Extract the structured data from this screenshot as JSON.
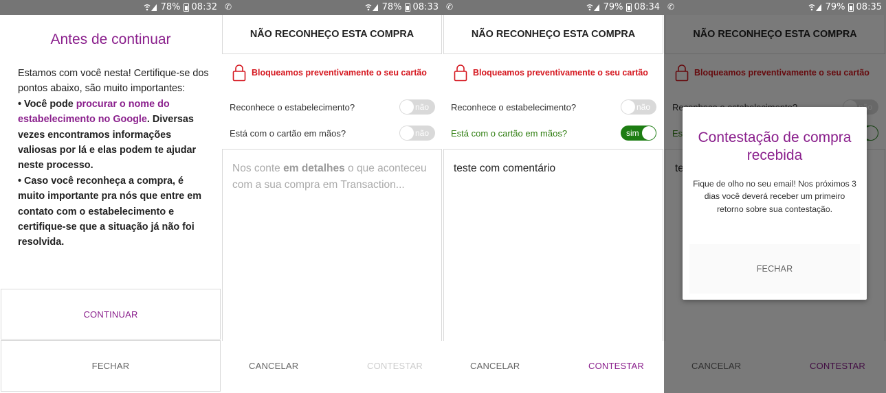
{
  "status_bars": [
    {
      "whatsapp": false,
      "battery": "78%",
      "time": "08:32"
    },
    {
      "whatsapp": true,
      "battery": "78%",
      "time": "08:33"
    },
    {
      "whatsapp": true,
      "battery": "79%",
      "time": "08:34"
    },
    {
      "whatsapp": true,
      "battery": "79%",
      "time": "08:35"
    }
  ],
  "screen1": {
    "title": "Antes de continuar",
    "intro": "Estamos com você nesta! Certifique-se dos pontos abaixo, são muito importantes:",
    "bullet1_pre": "• Você pode ",
    "bullet1_link": "procurar o nome do estabelecimento no Google",
    "bullet1_post": ". Diversas vezes encontramos informações valiosas por lá e elas podem te ajudar neste processo.",
    "bullet2": "• Caso você reconheça a compra, é muito importante pra nós que entre em contato com o estabelecimento e certifique-se que a situação já não foi resolvida.",
    "continue_label": "CONTINUAR",
    "close_label": "FECHAR"
  },
  "form": {
    "header": "NÃO RECONHEÇO ESTA COMPRA",
    "blocked_msg": "Bloqueamos preventivamente o seu cartão",
    "q1": "Reconhece o estabelecimento?",
    "q2": "Está com o cartão em mãos?",
    "toggle_off": "não",
    "toggle_on": "sim",
    "placeholder_pre": "Nos conte ",
    "placeholder_bold": "em detalhes",
    "placeholder_post": " o que aconteceu com a sua compra em Transaction...",
    "typed_comment": "teste com comentário",
    "cancel_label": "CANCELAR",
    "contest_label": "CONTESTAR"
  },
  "dialog": {
    "title": "Contestação de compra recebida",
    "body": "Fique de olho no seu email! Nos próximos 3 dias você deverá receber um primeiro retorno sobre sua contestação.",
    "close_label": "FECHAR"
  },
  "colors": {
    "brand_purple": "#8a1f8c",
    "alert_red": "#d5171f",
    "toggle_on_green": "#1d7d13",
    "status_bar_gray": "#757575"
  }
}
